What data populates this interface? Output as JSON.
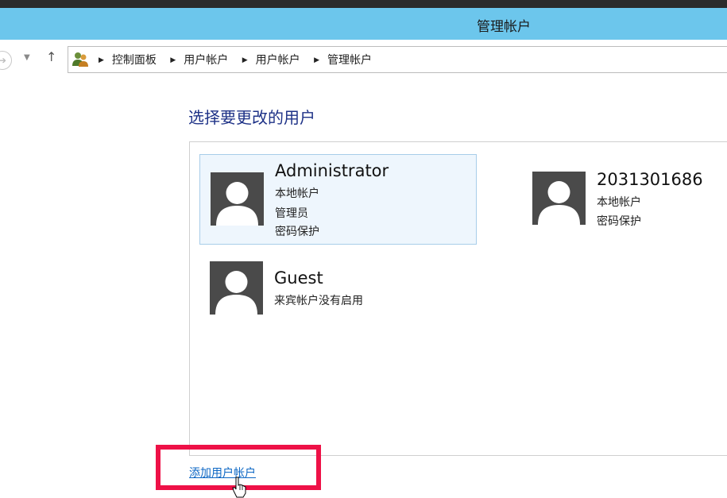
{
  "window": {
    "title": "管理帐户"
  },
  "address_bar": {
    "icon": "control-panel-users-icon",
    "crumbs": [
      "控制面板",
      "用户帐户",
      "用户帐户",
      "管理帐户"
    ]
  },
  "main": {
    "heading": "选择要更改的用户",
    "users": [
      {
        "name": "Administrator",
        "lines": [
          "本地帐户",
          "管理员",
          "密码保护"
        ],
        "selected": true
      },
      {
        "name": "2031301686",
        "lines": [
          "本地帐户",
          "密码保护"
        ],
        "selected": false
      },
      {
        "name": "Guest",
        "lines": [
          "来宾帐户没有启用"
        ],
        "selected": false
      }
    ],
    "add_user_link": "添加用户帐户"
  },
  "colors": {
    "titlebar": "#6cc6ec",
    "heading": "#1e3287",
    "link": "#0d67c4",
    "highlight": "#ee1147",
    "avatar_bg": "#4a4a4a"
  }
}
